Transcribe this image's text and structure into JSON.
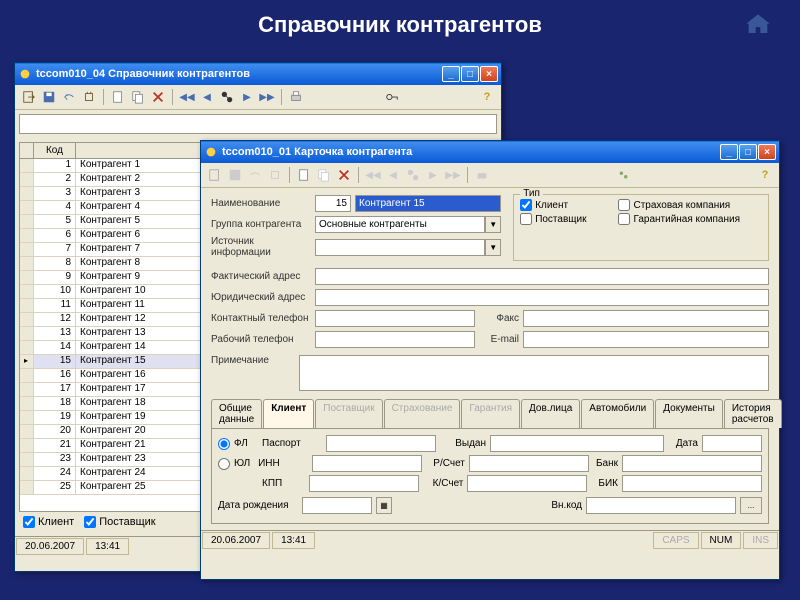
{
  "main_title": "Справочник контрагентов",
  "win1": {
    "title": "tccom010_04  Справочник контрагентов",
    "columns": {
      "code": "Код",
      "name": ""
    },
    "rows": [
      {
        "code": "1",
        "name": "Контрагент 1"
      },
      {
        "code": "2",
        "name": "Контрагент 2"
      },
      {
        "code": "3",
        "name": "Контрагент 3"
      },
      {
        "code": "4",
        "name": "Контрагент 4"
      },
      {
        "code": "5",
        "name": "Контрагент 5"
      },
      {
        "code": "6",
        "name": "Контрагент 6"
      },
      {
        "code": "7",
        "name": "Контрагент 7"
      },
      {
        "code": "8",
        "name": "Контрагент 8"
      },
      {
        "code": "9",
        "name": "Контрагент 9"
      },
      {
        "code": "10",
        "name": "Контрагент 10"
      },
      {
        "code": "11",
        "name": "Контрагент 11"
      },
      {
        "code": "12",
        "name": "Контрагент 12"
      },
      {
        "code": "13",
        "name": "Контрагент 13"
      },
      {
        "code": "14",
        "name": "Контрагент 14"
      },
      {
        "code": "15",
        "name": "Контрагент 15"
      },
      {
        "code": "16",
        "name": "Контрагент 16"
      },
      {
        "code": "17",
        "name": "Контрагент 17"
      },
      {
        "code": "18",
        "name": "Контрагент 18"
      },
      {
        "code": "19",
        "name": "Контрагент 19"
      },
      {
        "code": "20",
        "name": "Контрагент 20"
      },
      {
        "code": "21",
        "name": "Контрагент 21"
      },
      {
        "code": "23",
        "name": "Контрагент 23"
      },
      {
        "code": "24",
        "name": "Контрагент 24"
      },
      {
        "code": "25",
        "name": "Контрагент 25"
      }
    ],
    "selected_index": 14,
    "filters": {
      "client": "Клиент",
      "supplier": "Поставщик"
    },
    "status": {
      "date": "20.06.2007",
      "time": "13:41"
    }
  },
  "win2": {
    "title": "tccom010_01  Карточка контрагента",
    "fields": {
      "name_label": "Наименование",
      "name_code": "15",
      "name_value": "Контрагент 15",
      "group_label": "Группа контрагента",
      "group_value": "Основные контрагенты",
      "source_label": "Источник информации",
      "source_value": "",
      "type_legend": "Тип",
      "type_client": "Клиент",
      "type_supplier": "Поставщик",
      "type_insurance": "Страховая компания",
      "type_guarantee": "Гарантийная компания",
      "fact_addr_label": "Фактический адрес",
      "legal_addr_label": "Юридический адрес",
      "phone_label": "Контактный телефон",
      "work_phone_label": "Рабочий телефон",
      "fax_label": "Факс",
      "email_label": "E-mail",
      "note_label": "Примечание"
    },
    "tabs": {
      "common": "Общие данные",
      "client": "Клиент",
      "supplier": "Поставщик",
      "insurance": "Страхование",
      "guarantee": "Гарантия",
      "contacts": "Дов.лица",
      "cars": "Автомобили",
      "docs": "Документы",
      "history": "История расчетов"
    },
    "client_pane": {
      "fl": "ФЛ",
      "ul": "ЮЛ",
      "passport": "Паспорт",
      "issued": "Выдан",
      "date": "Дата",
      "inn": "ИНН",
      "kpp": "КПП",
      "r_account": "Р/Счет",
      "k_account": "К/Счет",
      "bank": "Банк",
      "bik": "БИК",
      "birth": "Дата рождения",
      "ext_code": "Вн.код",
      "ellipsis": "..."
    },
    "status": {
      "date": "20.06.2007",
      "time": "13:41",
      "caps": "CAPS",
      "num": "NUM",
      "ins": "INS"
    }
  }
}
